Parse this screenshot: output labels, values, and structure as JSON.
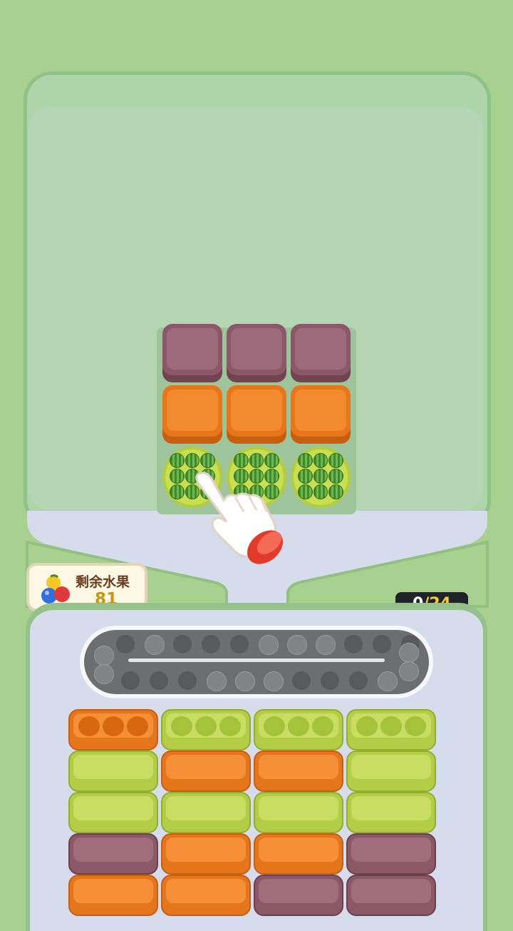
{
  "hud": {
    "remaining_label": "剩余水果",
    "remaining_count": "81",
    "progress_current": "0",
    "progress_separator": "/",
    "progress_total": "24"
  },
  "board_tiles": [
    [
      "purple",
      "purple",
      "purple"
    ],
    [
      "orange",
      "orange",
      "orange"
    ],
    [
      "watermelon",
      "watermelon",
      "watermelon"
    ]
  ],
  "conveyor": {
    "top_row": [
      "dark",
      "light",
      "dark",
      "dark",
      "dark",
      "light",
      "light",
      "light",
      "dark",
      "dark",
      "dark"
    ],
    "bottom_row": [
      "dark",
      "dark",
      "dark",
      "light",
      "light",
      "light",
      "dark",
      "dark",
      "dark",
      "light"
    ],
    "left_end": [
      "light",
      "light"
    ],
    "right_end": [
      "light",
      "light"
    ]
  },
  "crates": [
    [
      "orange-open",
      "green-open",
      "green-open",
      "green-open"
    ],
    [
      "green",
      "orange",
      "orange",
      "green"
    ],
    [
      "green",
      "green",
      "green",
      "green"
    ],
    [
      "purple",
      "orange",
      "orange",
      "purple"
    ],
    [
      "orange",
      "orange",
      "purple",
      "purple"
    ]
  ],
  "colors": {
    "background": "#a8d08e",
    "purple": "#9c6a7a",
    "orange": "#f28a2e",
    "green": "#cadd63",
    "gold": "#c69416"
  },
  "icons": {
    "hand": "pointing-hand-icon",
    "fruits": "fruit-cluster-icon"
  }
}
